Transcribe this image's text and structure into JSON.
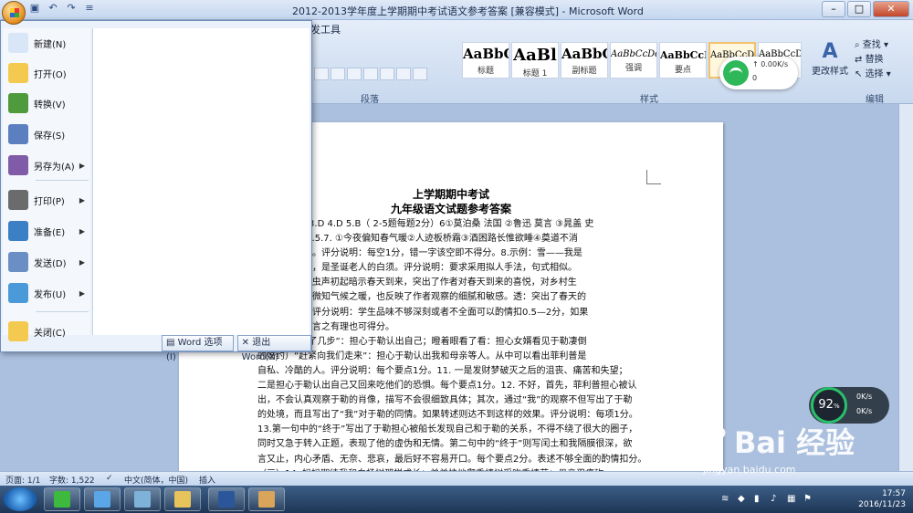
{
  "window": {
    "title": "2012-2013学年度上学期期中考试语文参考答案 [兼容模式] - Microsoft Word",
    "tab_dev": "发工具"
  },
  "ribbon": {
    "styles": [
      {
        "sample": "AaBbC",
        "name": "标题"
      },
      {
        "sample": "AaBl",
        "name": "标题 1"
      },
      {
        "sample": "AaBbC",
        "name": "副标题"
      },
      {
        "sample": "AaBbCcDd",
        "name": "强调"
      },
      {
        "sample": "AaBbCcD",
        "name": "要点"
      },
      {
        "sample": "AaBbCcDc",
        "name": ""
      },
      {
        "sample": "AaBbCcDc",
        "name": ""
      }
    ],
    "change_styles": "更改样式",
    "group_paragraph": "段落",
    "group_styles": "样式",
    "group_edit": "编辑",
    "edit_find": "查找",
    "edit_replace": "替换",
    "edit_select": "选择"
  },
  "office_menu": {
    "items": [
      {
        "label": "新建(N)",
        "icon": "new-doc-icon",
        "arrow": ""
      },
      {
        "label": "打开(O)",
        "icon": "open-folder-icon",
        "arrow": ""
      },
      {
        "label": "转换(V)",
        "icon": "convert-icon",
        "arrow": ""
      },
      {
        "label": "保存(S)",
        "icon": "save-icon",
        "arrow": ""
      },
      {
        "label": "另存为(A)",
        "icon": "save-as-icon",
        "arrow": "▶"
      },
      {
        "label": "打印(P)",
        "icon": "print-icon",
        "arrow": "▶"
      },
      {
        "label": "准备(E)",
        "icon": "prepare-icon",
        "arrow": "▶"
      },
      {
        "label": "发送(D)",
        "icon": "send-icon",
        "arrow": "▶"
      },
      {
        "label": "发布(U)",
        "icon": "publish-icon",
        "arrow": "▶"
      },
      {
        "label": "关闭(C)",
        "icon": "close-folder-icon",
        "arrow": ""
      }
    ],
    "word_options": "Word 选项(I)",
    "exit_word": "退出 Word(X)"
  },
  "document": {
    "title1": "上学期期中考试",
    "title2": "九年级语文试题参考答案",
    "lines": [
      "分）二. 2.C 3.D 4.D 5.B（ 2-5题每题2分）6①莫泊桑 法国  ②鲁迅 莫言 ③晁盖 史",
      "，错一空扣 0.5.7. ①今夜偏知春气暖②人迹板桥霜③酒困路长惟欲睡④奠道不消",
      "，人比黄花瘦。评分说明：每空1分，错一字该空即不得分。8.示例：雪——我是",
      "是天使的衣袂，是圣诞老人的白须。评分说明：要求采用拟人手法，句式相似。",
      ") 9. 新：说明虫声初起暗示春天到来，突出了作者对春天到来的喜悦，对乡村生",
      "静中求出声之微知气候之暖，也反映了作者观察的细腻和敏感。透：突出了春天的",
      "富有力度感。评分说明：学生品味不够深刻或者不全面可以酌情扣0.5—2分，如果",
      "角度品味，如言之有理也可得分。",
      "). “向旁边走了几步”：担心于勒认出自己；瞪着眼看了看：担心女婿看见于勒凄倒",
      "的婚约）“赶紧向我们走来”：担心于勒认出我和母亲等人。从中可以看出菲利普是",
      "自私、冷酷的人。评分说明：每个要点1分。11. 一是发财梦破灭之后的沮丧、痛苦和失望；",
      "二是担心于勒认出自己又回来吃他们的恐惧。每个要点1分。12. 不好，首先，菲利普担心被认",
      "出，不会认真观察于勒的肖像，描写不会很细致具体；其次，通过“我”的观察不但写出了于勒",
      "的处境，而且写出了“我”对于勒的同情。如果转述则达不到这样的效果。评分说明：每项1分。",
      "13.第一句中的“终于”写出了于勒担心被船长发现自己和于勒的关系，不得不绕了很大的圈子，",
      "同时又急于转入正题，表现了他的虚伪和无情。第二句中的“终于”则写闰土和我隔膜很深，欲",
      "言又止，内心矛盾、无奈、悲哀，最后好不容易开口。每个要点2分。表述不够全面的酌情扣分。",
      "（三）14. 妈妈期待我和白杨树那样成长；弟弟快地爬香椿树采吃香椿芽；母亲忍痛砍",
      "掉给我们家带来欢乐的杨子树。每项1分。15. ⑤段：  指滋味美，心情好。⑥段：指脖子林的",
      "美景，也指“我”看到孩子们羡慕咽口水时的得意心情。每项2分。16. 照应开头，（2分）表现了"
    ]
  },
  "wifi_popup": {
    "upload": "0.00K/s",
    "download": "0"
  },
  "speed_gauge": {
    "percent": "92",
    "unit": "%",
    "up": "0K/s",
    "down": "0K/s"
  },
  "watermark": {
    "brand": "Bai 经验",
    "url": "jingyan.baidu.com"
  },
  "statusbar": {
    "page": "页面: 1/1",
    "words": "字数: 1,522",
    "lang": "中文(简体，中国)",
    "mode": "插入"
  },
  "taskbar": {
    "time": "17:57",
    "date": "2016/11/23"
  }
}
